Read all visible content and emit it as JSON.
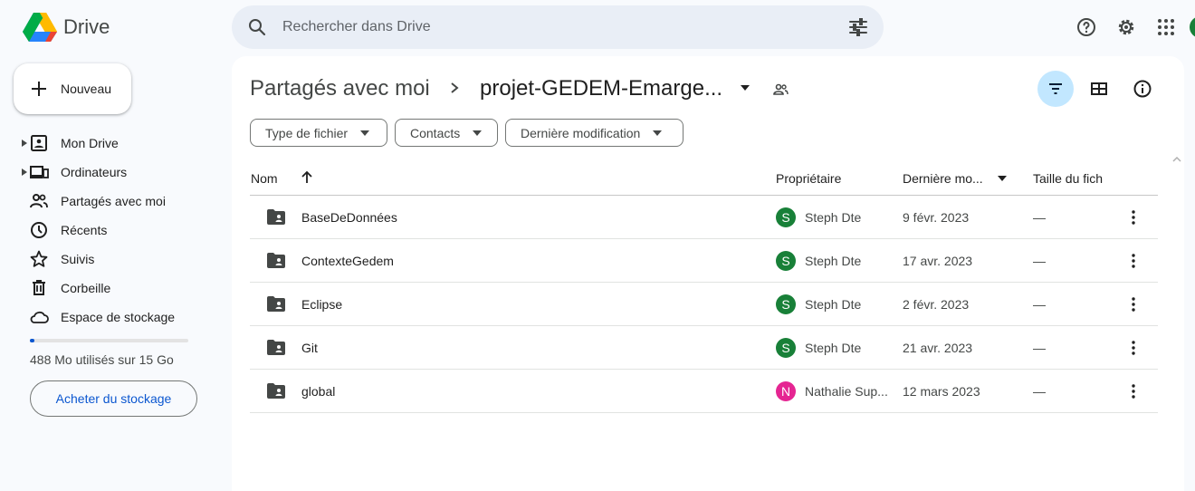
{
  "app": {
    "name": "Drive"
  },
  "search": {
    "placeholder": "Rechercher dans Drive"
  },
  "sidebar": {
    "new_button": "Nouveau",
    "items": [
      {
        "label": "Mon Drive",
        "icon": "my-drive-icon",
        "expandable": true
      },
      {
        "label": "Ordinateurs",
        "icon": "computers-icon",
        "expandable": true
      },
      {
        "label": "Partagés avec moi",
        "icon": "shared-icon",
        "expandable": false
      },
      {
        "label": "Récents",
        "icon": "clock-icon",
        "expandable": false
      },
      {
        "label": "Suivis",
        "icon": "star-icon",
        "expandable": false
      },
      {
        "label": "Corbeille",
        "icon": "trash-icon",
        "expandable": false
      },
      {
        "label": "Espace de stockage",
        "icon": "cloud-icon",
        "expandable": false
      }
    ],
    "storage": {
      "used_fraction": 0.03,
      "text": "488 Mo utilisés sur 15 Go",
      "buy_label": "Acheter du stockage"
    }
  },
  "breadcrumb": {
    "root": "Partagés avec moi",
    "current": "projet-GEDEM-Emarge..."
  },
  "filters": [
    "Type de fichier",
    "Contacts",
    "Dernière modification"
  ],
  "table": {
    "headers": {
      "name": "Nom",
      "owner": "Propriétaire",
      "modified": "Dernière mo...",
      "size": "Taille du fich"
    },
    "rows": [
      {
        "name": "BaseDeDonnées",
        "owner_initial": "S",
        "owner": "Steph Dte",
        "owner_color": "#188038",
        "modified": "9 févr. 2023",
        "size": "—"
      },
      {
        "name": "ContexteGedem",
        "owner_initial": "S",
        "owner": "Steph Dte",
        "owner_color": "#188038",
        "modified": "17 avr. 2023",
        "size": "—"
      },
      {
        "name": "Eclipse",
        "owner_initial": "S",
        "owner": "Steph Dte",
        "owner_color": "#188038",
        "modified": "2 févr. 2023",
        "size": "—"
      },
      {
        "name": "Git",
        "owner_initial": "S",
        "owner": "Steph Dte",
        "owner_color": "#188038",
        "modified": "21 avr. 2023",
        "size": "—"
      },
      {
        "name": "global",
        "owner_initial": "N",
        "owner": "Nathalie Sup...",
        "owner_color": "#e52592",
        "modified": "12 mars 2023",
        "size": "—"
      }
    ]
  },
  "colors": {
    "accent": "#0b57d0",
    "active_view": "#c2e7ff",
    "surface": "#f8fafd"
  }
}
